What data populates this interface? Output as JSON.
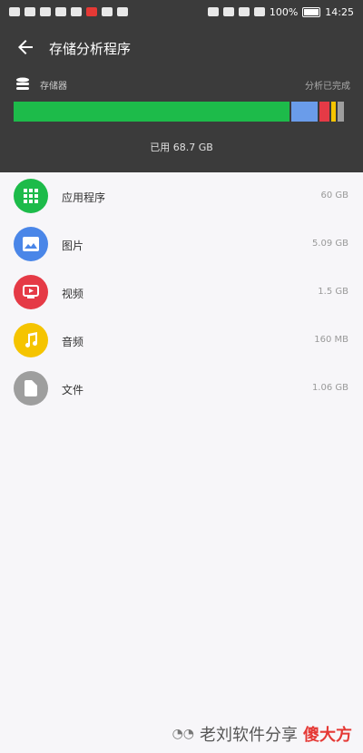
{
  "status_bar": {
    "battery": "100%",
    "time": "14:25"
  },
  "header": {
    "title": "存储分析程序",
    "storage_label": "存储器",
    "storage_status": "分析已完成",
    "used_text": "已用 68.7 GB"
  },
  "bar_segments": [
    {
      "color": "#1dbb4a",
      "fraction": 0.835
    },
    {
      "color": "#6a9cea",
      "fraction": 0.08
    },
    {
      "color": "#e53a46",
      "fraction": 0.03
    },
    {
      "color": "#f5c400",
      "fraction": 0.015
    },
    {
      "color": "#9e9e9e",
      "fraction": 0.02
    }
  ],
  "items": [
    {
      "label": "应用程序",
      "size": "60 GB",
      "color": "#1dbb4a",
      "icon": "grid-icon"
    },
    {
      "label": "图片",
      "size": "5.09 GB",
      "color": "#4a86e8",
      "icon": "image-icon"
    },
    {
      "label": "视频",
      "size": "1.5 GB",
      "color": "#e53a46",
      "icon": "video-icon"
    },
    {
      "label": "音频",
      "size": "160 MB",
      "color": "#f5c400",
      "icon": "music-icon"
    },
    {
      "label": "文件",
      "size": "1.06 GB",
      "color": "#9e9e9e",
      "icon": "file-icon"
    }
  ],
  "watermark": {
    "text": "老刘软件分享",
    "brand": "傻大方"
  }
}
